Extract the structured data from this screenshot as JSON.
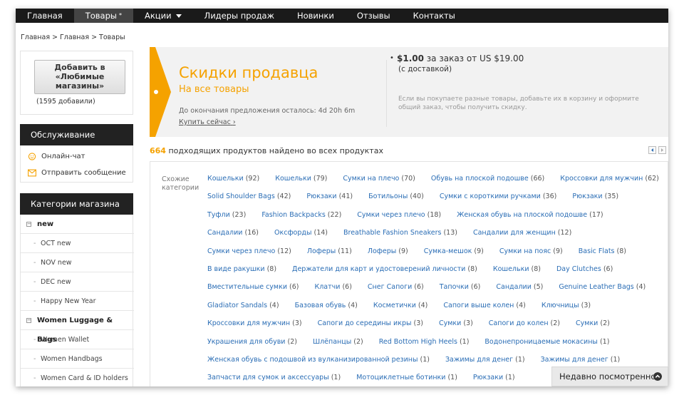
{
  "nav": [
    {
      "label": "Главная",
      "active": false
    },
    {
      "label": "Товары",
      "active": true,
      "marker": "*"
    },
    {
      "label": "Акции",
      "active": false,
      "caret": true
    },
    {
      "label": "Лидеры продаж",
      "active": false
    },
    {
      "label": "Новинки",
      "active": false
    },
    {
      "label": "Отзывы",
      "active": false
    },
    {
      "label": "Контакты",
      "active": false
    }
  ],
  "breadcrumb": [
    "Главная",
    "Главная",
    "Товары"
  ],
  "breadcrumb_sep": ">",
  "favorite": {
    "button_label": "Добавить в\n«Любимые\nмагазины»",
    "count": "(1595 добавили)"
  },
  "service": {
    "title": "Обслуживание",
    "items": [
      {
        "label": "Онлайн-чат",
        "icon": "chat-smile-icon"
      },
      {
        "label": "Отправить сообщение",
        "icon": "envelope-icon"
      }
    ]
  },
  "categories": {
    "title": "Категории магазина",
    "groups": [
      {
        "name": "new",
        "items": [
          "OCT new",
          "NOV new",
          "DEC new",
          "Happy New Year"
        ]
      },
      {
        "name": "Women Luggage & Bags",
        "items": [
          "Women Wallet",
          "Women Handbags",
          "Women Card & ID holders"
        ]
      }
    ]
  },
  "promo": {
    "title": "Скидки продавца",
    "subtitle": "На все товары",
    "time_left": "До окончания предложения осталось: 4d 20h 6m",
    "buy_link": "Купить сейчас",
    "bullet": "•",
    "discount_amount": "$1.00",
    "discount_mid": "за заказ от",
    "discount_min": "US $19.00",
    "delivery": "(с доставкой)",
    "note": "Если вы покупаете разные товары, добавьте их в корзину и оформите общий заказ, чтобы получить скидку."
  },
  "results": {
    "count": "664",
    "text": "подходящих продуктов найдено во всех продуктах"
  },
  "related": {
    "label": "Схожие категории",
    "rows": [
      [
        [
          "Кошельки",
          "(92)"
        ],
        [
          "Кошельки",
          "(79)"
        ],
        [
          "Сумки на плечо",
          "(70)"
        ],
        [
          "Обувь на плоской подошве",
          "(66)"
        ],
        [
          "Кроссовки для мужчин",
          "(62)"
        ]
      ],
      [
        [
          "Solid Shoulder Bags",
          "(42)"
        ],
        [
          "Рюкзаки",
          "(41)"
        ],
        [
          "Ботильоны",
          "(40)"
        ],
        [
          "Сумки с короткими ручками",
          "(36)"
        ],
        [
          "Рюкзаки",
          "(35)"
        ]
      ],
      [
        [
          "Туфли",
          "(23)"
        ],
        [
          "Fashion Backpacks",
          "(22)"
        ],
        [
          "Сумки через плечо",
          "(18)"
        ],
        [
          "Женская обувь на плоской подошве",
          "(17)"
        ]
      ],
      [
        [
          "Сандалии",
          "(16)"
        ],
        [
          "Оксфорды",
          "(14)"
        ],
        [
          "Breathable Fashion Sneakers",
          "(13)"
        ],
        [
          "Сандалии для женщин",
          "(12)"
        ]
      ],
      [
        [
          "Сумки через плечо",
          "(12)"
        ],
        [
          "Лоферы",
          "(11)"
        ],
        [
          "Лоферы",
          "(9)"
        ],
        [
          "Сумка-мешок",
          "(9)"
        ],
        [
          "Сумки на пояс",
          "(9)"
        ],
        [
          "Basic Flats",
          "(8)"
        ]
      ],
      [
        [
          "В виде ракушки",
          "(8)"
        ],
        [
          "Держатели для карт и удостоверений личности",
          "(8)"
        ],
        [
          "Кошельки",
          "(8)"
        ],
        [
          "Day Clutches",
          "(6)"
        ]
      ],
      [
        [
          "Вместительные сумки",
          "(6)"
        ],
        [
          "Клатчи",
          "(6)"
        ],
        [
          "Снег Сапоги",
          "(6)"
        ],
        [
          "Тапочки",
          "(6)"
        ],
        [
          "Сандалии",
          "(5)"
        ],
        [
          "Genuine Leather Bags",
          "(4)"
        ]
      ],
      [
        [
          "Gladiator Sandals",
          "(4)"
        ],
        [
          "Базовая обувь",
          "(4)"
        ],
        [
          "Косметички",
          "(4)"
        ],
        [
          "Сапоги выше колен",
          "(4)"
        ],
        [
          "Ключницы",
          "(3)"
        ]
      ],
      [
        [
          "Кроссовки для мужчин",
          "(3)"
        ],
        [
          "Сапоги до середины икры",
          "(3)"
        ],
        [
          "Сумки",
          "(3)"
        ],
        [
          "Сапоги до колен",
          "(2)"
        ],
        [
          "Сумки",
          "(2)"
        ]
      ],
      [
        [
          "Украшения для обуви",
          "(2)"
        ],
        [
          "Шлёпанцы",
          "(2)"
        ],
        [
          "Red Bottom High Heels",
          "(1)"
        ],
        [
          "Водонепроницаемые мокасины",
          "(1)"
        ]
      ],
      [
        [
          "Женская обувь с подошвой из вулканизированной резины",
          "(1)"
        ],
        [
          "Зажимы для денег",
          "(1)"
        ],
        [
          "Зажимы для денег",
          "(1)"
        ]
      ],
      [
        [
          "Запчасти для сумок и аксессуары",
          "(1)"
        ],
        [
          "Мотоциклетные ботинки",
          "(1)"
        ],
        [
          "Рюкзаки",
          "(1)"
        ]
      ]
    ]
  },
  "recently_viewed": "Недавно посмотренное",
  "colors": {
    "accent": "#f5a200",
    "link": "#2a6db5",
    "nav_bg": "#1a1a1a"
  }
}
